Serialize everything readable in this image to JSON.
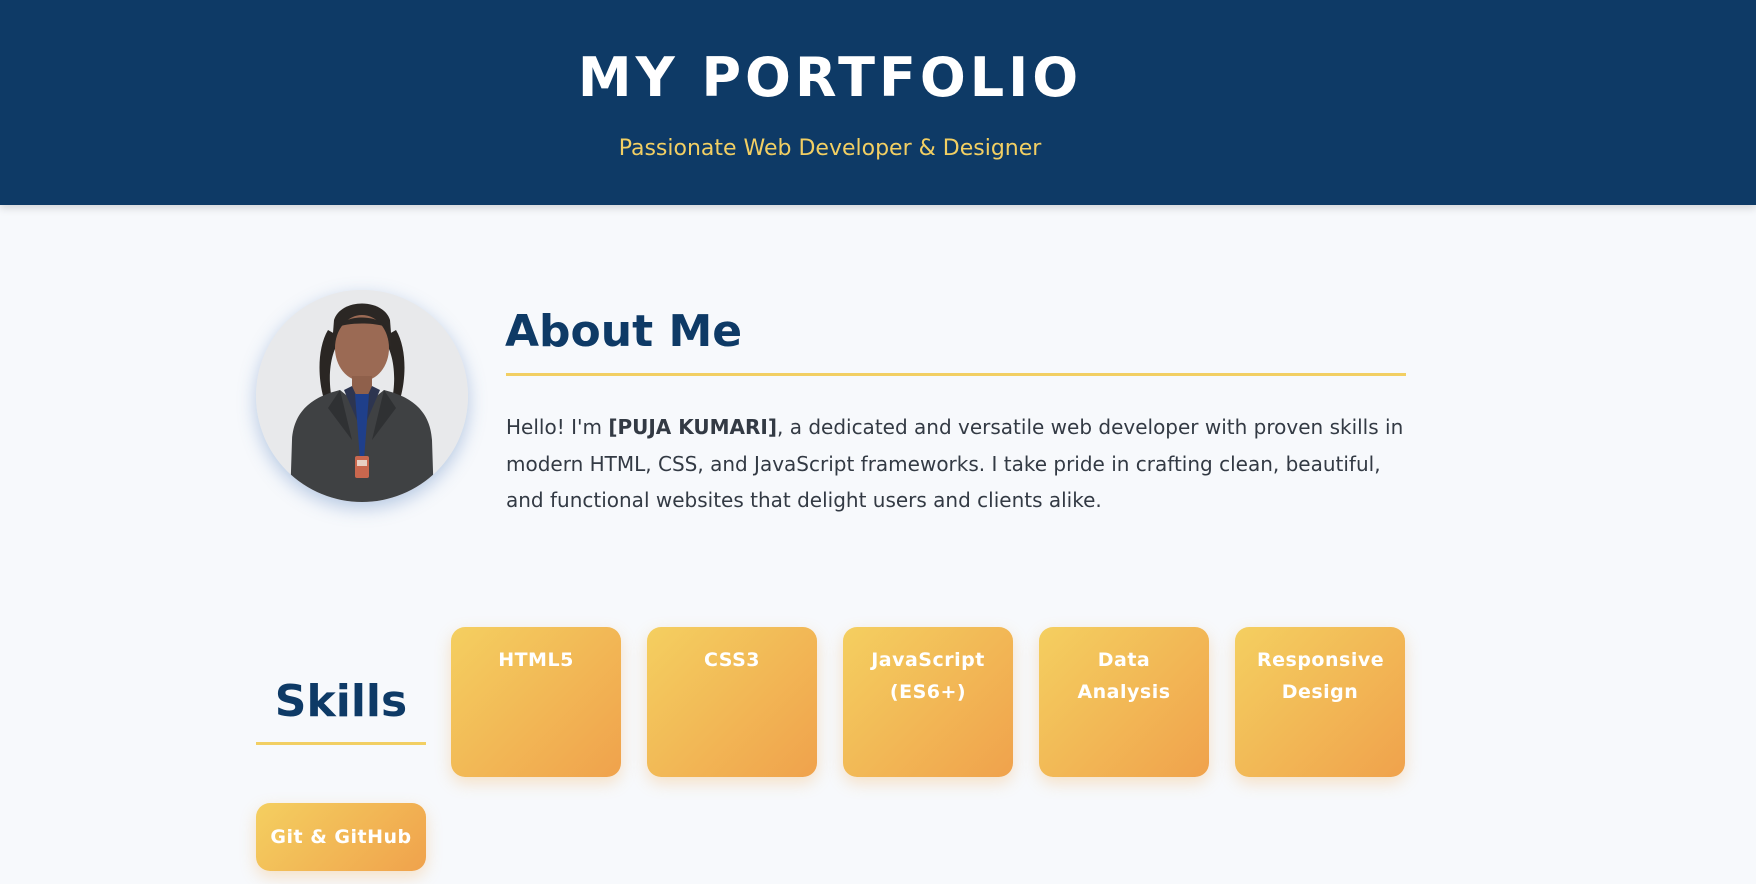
{
  "header": {
    "title": "MY PORTFOLIO",
    "tagline": "Passionate Web Developer & Designer"
  },
  "about": {
    "title": "About Me",
    "intro_prefix": "Hello! I'm ",
    "name": "[PUJA KUMARI]",
    "intro_suffix": ", a dedicated and versatile web developer with proven skills in modern HTML, CSS, and JavaScript frameworks. I take pride in crafting clean, beautiful, and functional websites that delight users and clients alike."
  },
  "skills": {
    "title": "Skills",
    "items": [
      {
        "label": "HTML5"
      },
      {
        "label": "CSS3"
      },
      {
        "label": "JavaScript (ES6+)"
      },
      {
        "label": "Data Analysis"
      },
      {
        "label": "Responsive Design"
      },
      {
        "label": "Git & GitHub"
      }
    ]
  },
  "colors": {
    "header_bg": "#0e3a66",
    "accent": "#f2cf63",
    "card_gradient_start": "#f4cf60",
    "card_gradient_end": "#f0a24c",
    "page_bg": "#f7f9fc"
  }
}
